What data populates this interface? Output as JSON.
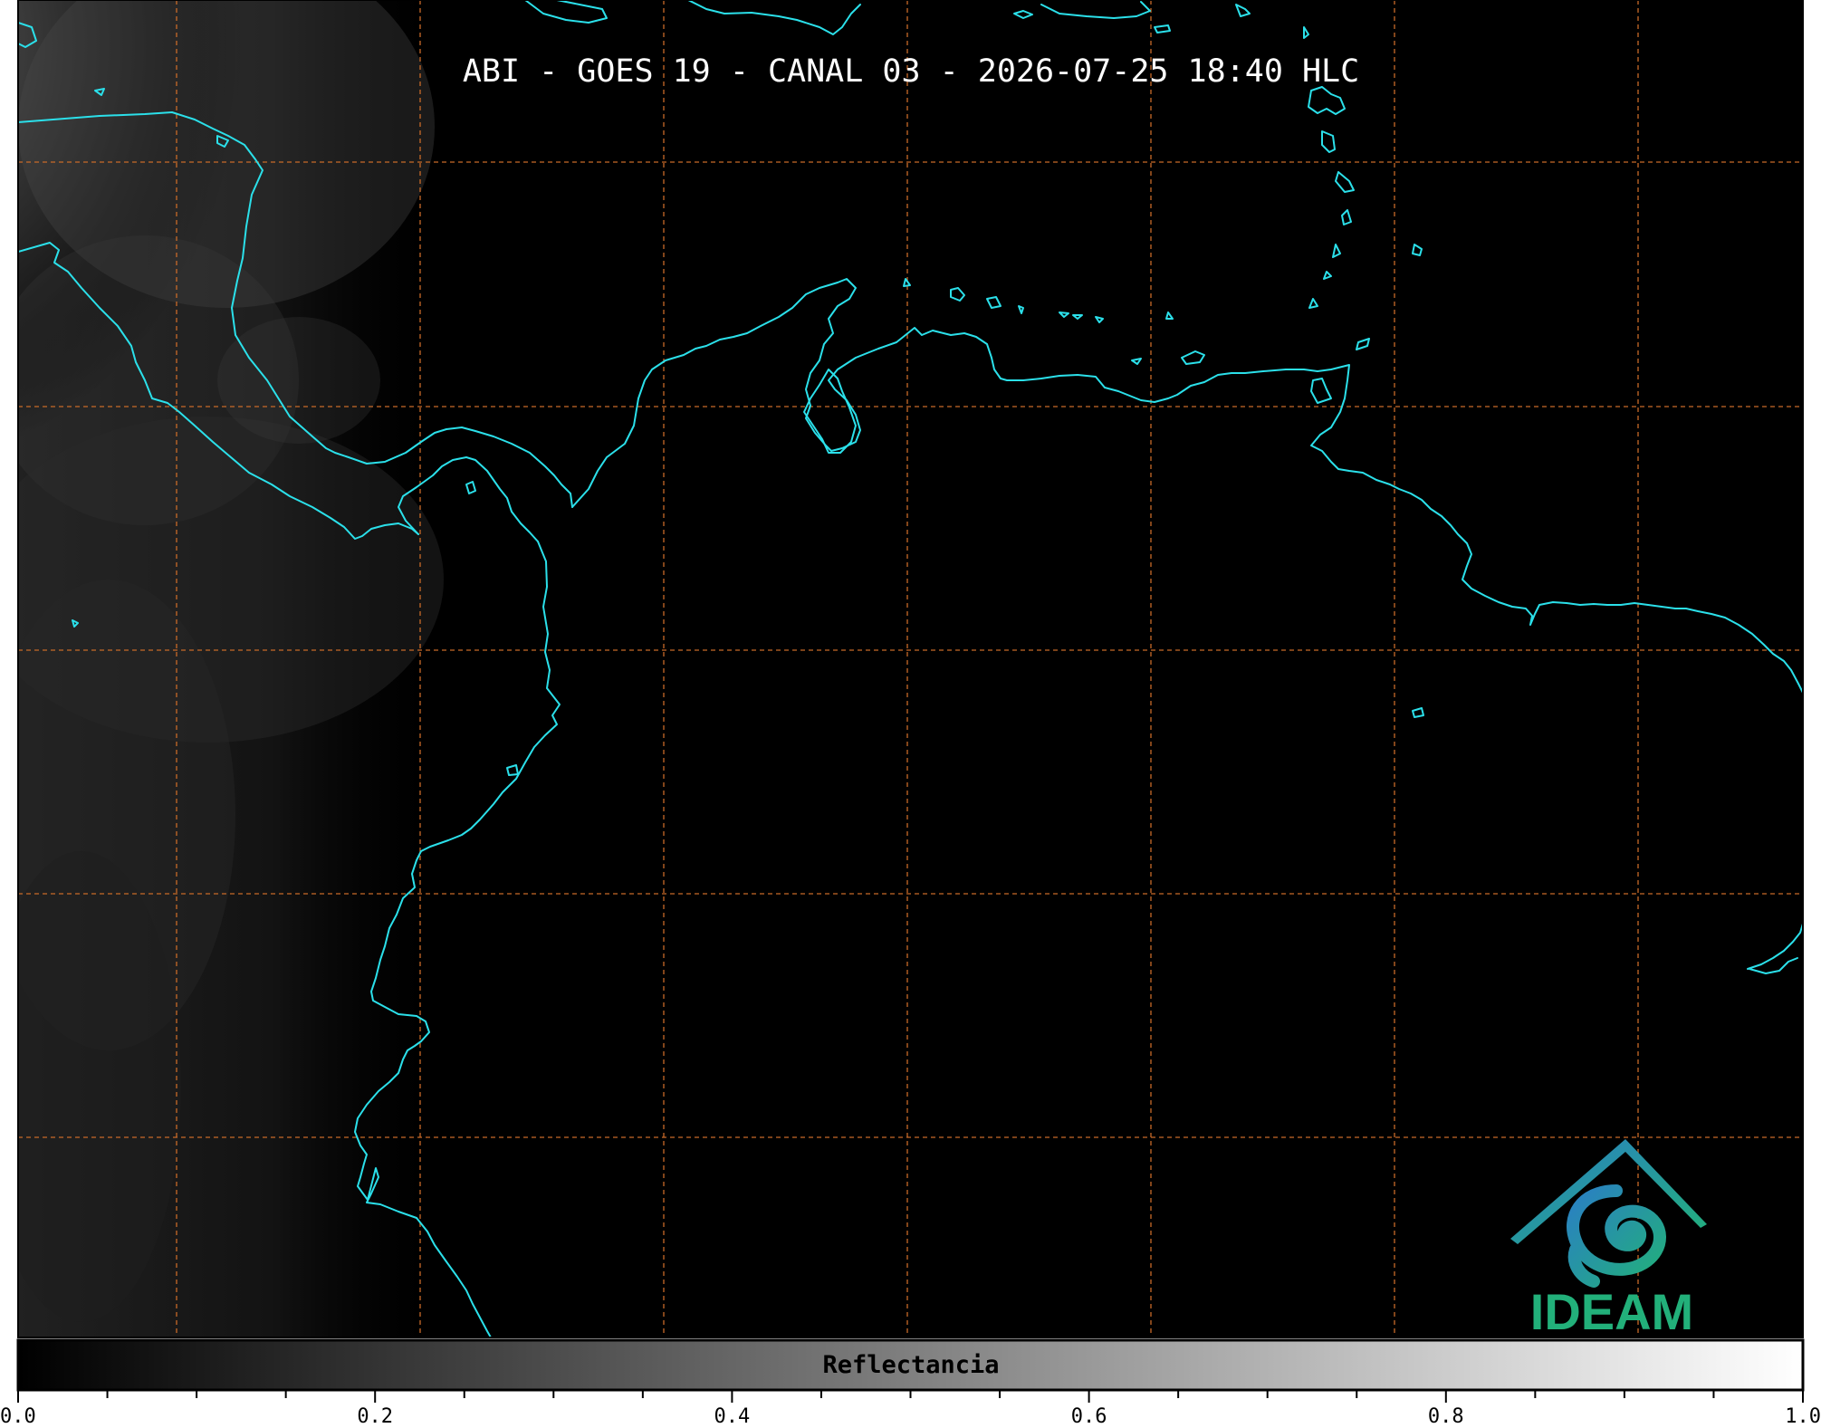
{
  "title": "ABI - GOES 19 - CANAL 03 - 2026-07-25 18:40 HLC",
  "colorbar": {
    "label": "Reflectancia",
    "min": 0.0,
    "max": 1.0,
    "tick_labels": [
      "0.0",
      "0.2",
      "0.4",
      "0.6",
      "0.8",
      "1.0"
    ],
    "colors": [
      "#000000",
      "#ffffff"
    ]
  },
  "logo": {
    "text": "IDEAM",
    "colors": {
      "roof": "#2a8fc0",
      "swirl": "#23a98f",
      "text": "#22b07a"
    }
  },
  "map_style": {
    "background": "#000000",
    "coastline_color": "#2be0ea",
    "gridline_color": "#c86a28"
  }
}
